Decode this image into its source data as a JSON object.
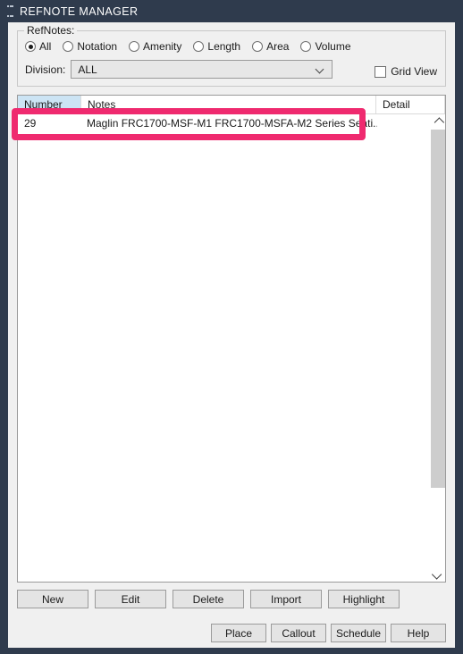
{
  "window": {
    "title": "REFNOTE MANAGER",
    "grip_icon": "grip-dots-icon",
    "titlebar_color": "#2f3b4d",
    "panel_color": "#f0f0f0"
  },
  "annotation": {
    "color": "#ef2a6f",
    "shape": "rectangle-outline",
    "target": "first-table-row"
  },
  "refnotes_group": {
    "legend": "RefNotes:",
    "radios": [
      {
        "label": "All",
        "checked": true
      },
      {
        "label": "Notation",
        "checked": false
      },
      {
        "label": "Amenity",
        "checked": false
      },
      {
        "label": "Length",
        "checked": false
      },
      {
        "label": "Area",
        "checked": false
      },
      {
        "label": "Volume",
        "checked": false
      }
    ],
    "division": {
      "label": "Division:",
      "value": "ALL",
      "chevron_icon": "chevron-down-icon"
    },
    "grid_view": {
      "label": "Grid View",
      "checked": false
    }
  },
  "table": {
    "columns": [
      {
        "label": "Number",
        "selected": true
      },
      {
        "label": "Notes",
        "selected": false
      },
      {
        "label": "Detail",
        "selected": false
      }
    ],
    "rows": [
      {
        "number": "29",
        "notes": "Maglin FRC1700-MSF-M1 FRC1700-MSFA-M2 Series Seati...",
        "detail": ""
      }
    ],
    "scrollbar": {
      "up_icon": "chevron-up-icon",
      "down_icon": "chevron-down-icon",
      "thumb_color": "#cdcdcd"
    }
  },
  "buttons_main": [
    {
      "label": "New"
    },
    {
      "label": "Edit"
    },
    {
      "label": "Delete"
    },
    {
      "label": "Import"
    },
    {
      "label": "Highlight"
    }
  ],
  "buttons_footer": [
    {
      "label": "Place"
    },
    {
      "label": "Callout"
    },
    {
      "label": "Schedule"
    },
    {
      "label": "Help"
    }
  ]
}
